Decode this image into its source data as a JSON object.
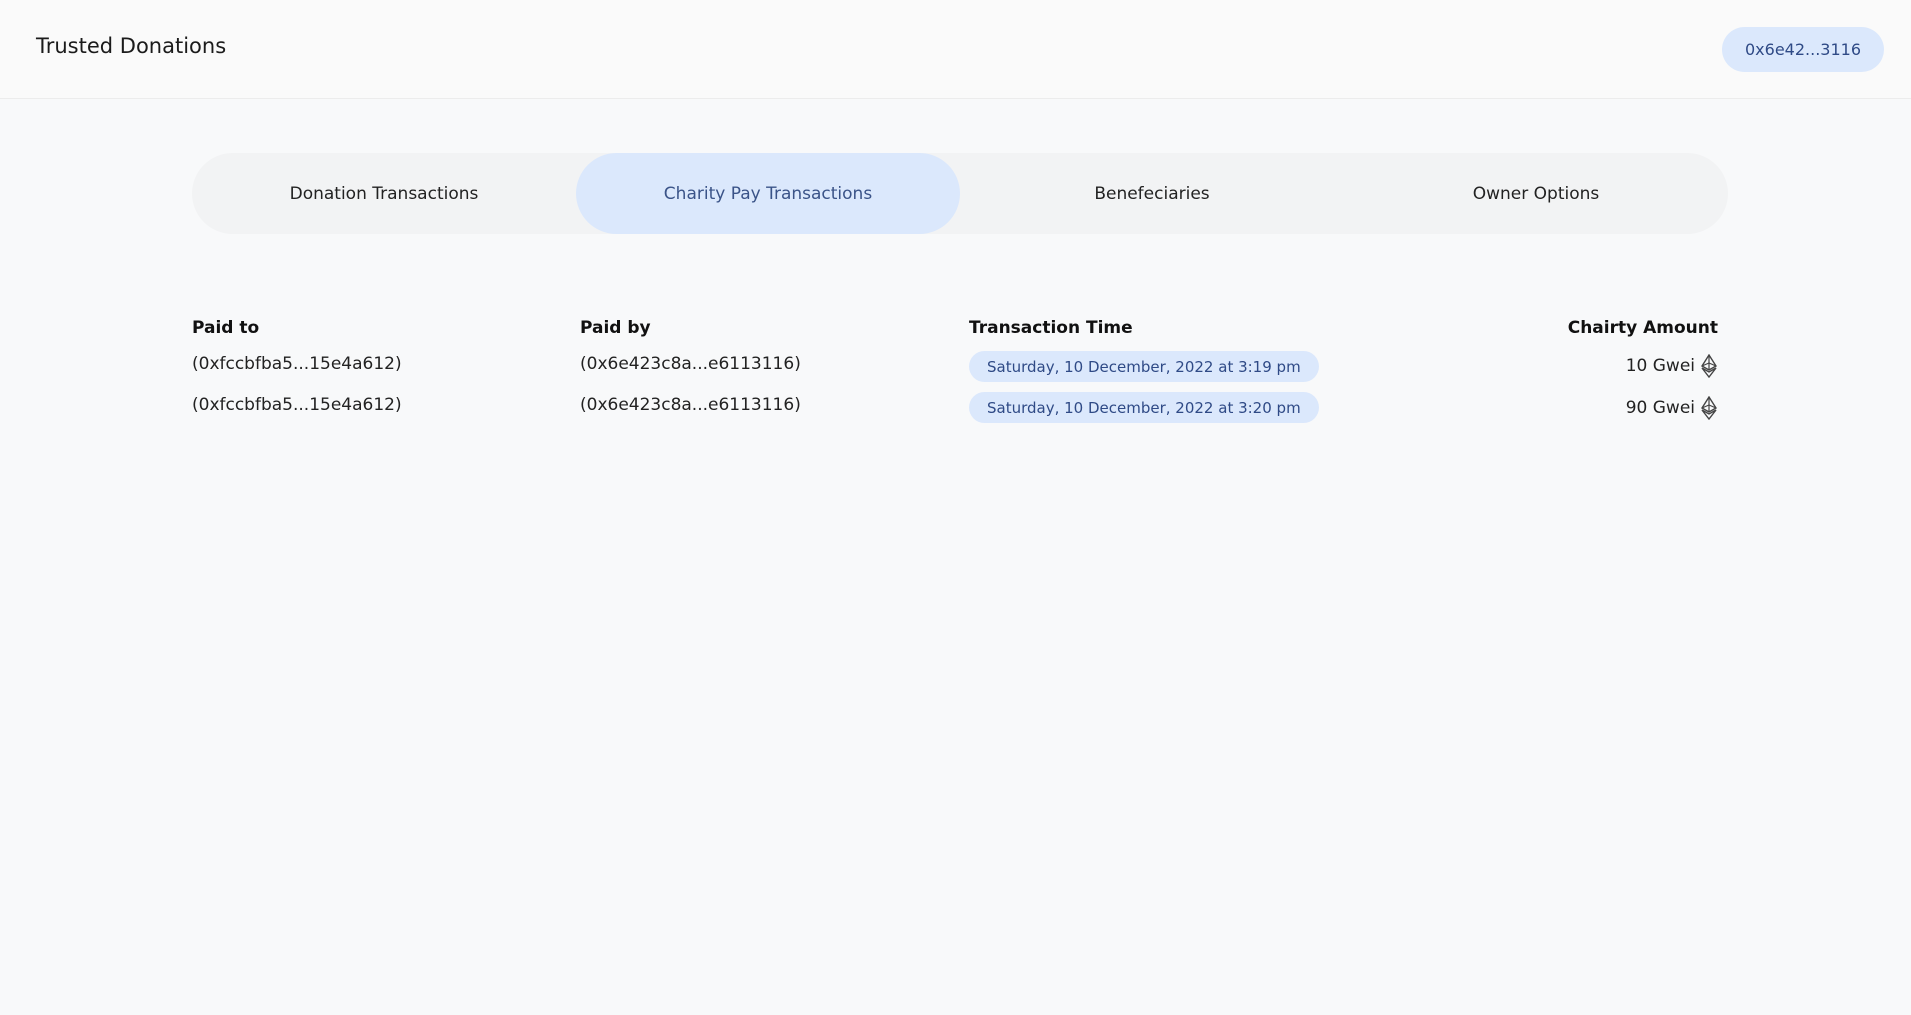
{
  "header": {
    "title": "Trusted Donations",
    "wallet": "0x6e42...3116"
  },
  "tabs": [
    {
      "label": "Donation Transactions",
      "active": false
    },
    {
      "label": "Charity Pay Transactions",
      "active": true
    },
    {
      "label": "Benefeciaries",
      "active": false
    },
    {
      "label": "Owner Options",
      "active": false
    }
  ],
  "table": {
    "headers": {
      "paid_to": "Paid to",
      "paid_by": "Paid by",
      "time": "Transaction Time",
      "amount": "Chairty Amount"
    },
    "rows": [
      {
        "paid_to": "(0xfccbfba5...15e4a612)",
        "paid_by": "(0x6e423c8a...e6113116)",
        "time": "Saturday, 10 December, 2022 at 3:19 pm",
        "amount": "10 Gwei"
      },
      {
        "paid_to": "(0xfccbfba5...15e4a612)",
        "paid_by": "(0x6e423c8a...e6113116)",
        "time": "Saturday, 10 December, 2022 at 3:20 pm",
        "amount": "90 Gwei"
      }
    ]
  },
  "icons": {
    "currency": "ethereum-icon"
  },
  "colors": {
    "accent_bg": "#dbe8fc",
    "accent_text": "#2f4a86",
    "page_bg": "#f8f9fa"
  }
}
